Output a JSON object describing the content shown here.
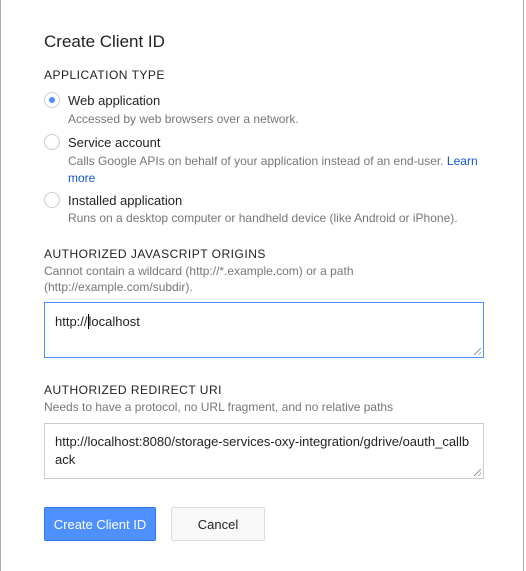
{
  "dialog": {
    "title": "Create Client ID",
    "application_type": {
      "heading": "APPLICATION TYPE",
      "options": [
        {
          "label": "Web application",
          "description": "Accessed by web browsers over a network.",
          "selected": true
        },
        {
          "label": "Service account",
          "description": "Calls Google APIs on behalf of your application instead of an end-user.",
          "link": "Learn more",
          "selected": false
        },
        {
          "label": "Installed application",
          "description": "Runs on a desktop computer or handheld device (like Android or iPhone).",
          "selected": false
        }
      ]
    },
    "js_origins": {
      "heading": "AUTHORIZED JAVASCRIPT ORIGINS",
      "help": "Cannot contain a wildcard (http://*.example.com) or a path (http://example.com/subdir).",
      "value_before_caret": "http://",
      "value_after_caret": "localhost"
    },
    "redirect_uri": {
      "heading": "AUTHORIZED REDIRECT URI",
      "help": "Needs to have a protocol, no URL fragment, and no relative paths",
      "value": "http://localhost:8080/storage-services-oxy-integration/gdrive/oauth_callback"
    },
    "buttons": {
      "create": "Create Client ID",
      "cancel": "Cancel"
    },
    "colors": {
      "accent": "#4d90fe",
      "link": "#1155cc"
    }
  }
}
